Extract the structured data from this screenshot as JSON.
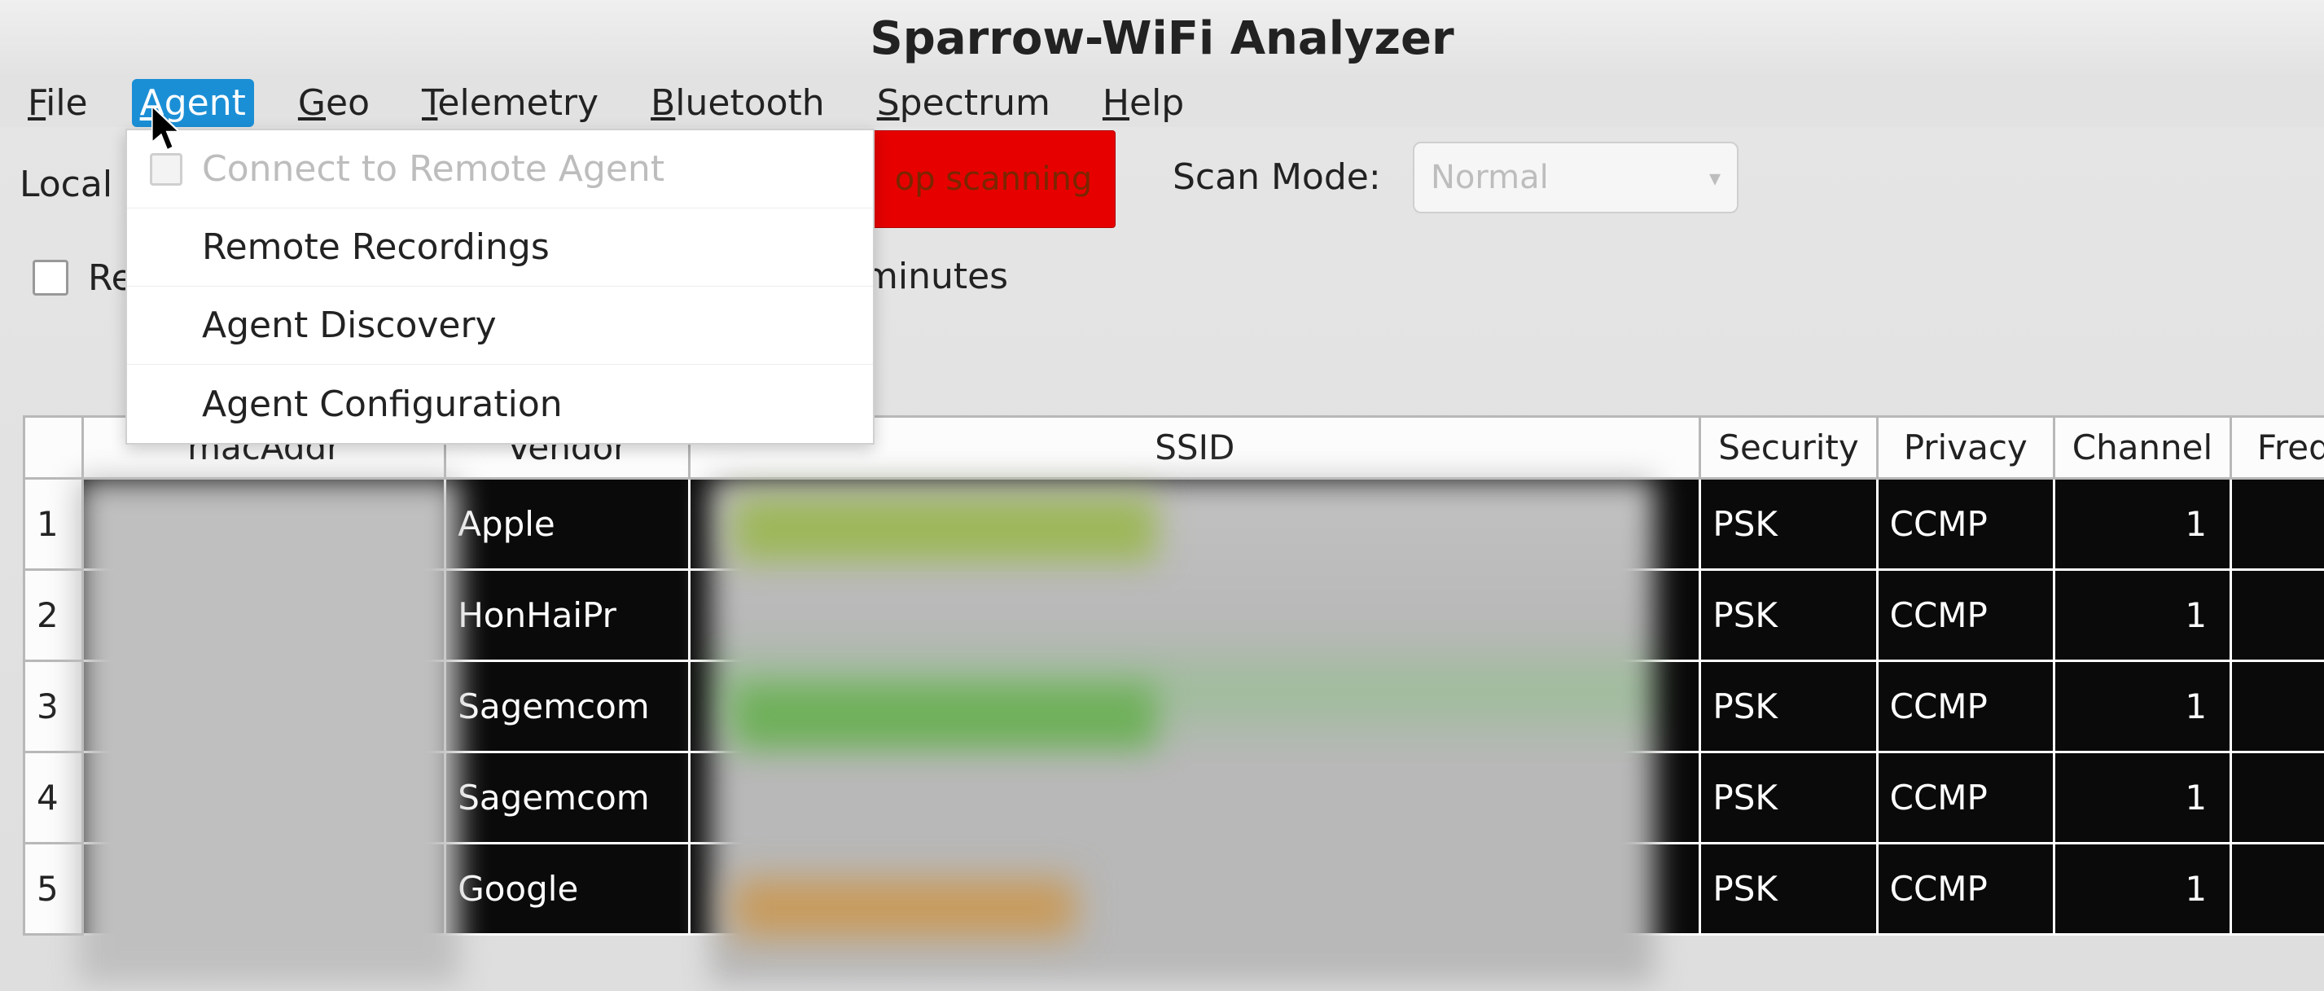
{
  "title": "Sparrow-WiFi Analyzer",
  "menubar": {
    "items": [
      {
        "label": "File",
        "mnemonic": "F"
      },
      {
        "label": "Agent",
        "mnemonic": "A",
        "active": true
      },
      {
        "label": "Geo",
        "mnemonic": "G"
      },
      {
        "label": "Telemetry",
        "mnemonic": "T"
      },
      {
        "label": "Bluetooth",
        "mnemonic": "B"
      },
      {
        "label": "Spectrum",
        "mnemonic": "S"
      },
      {
        "label": "Help",
        "mnemonic": "H"
      }
    ]
  },
  "agent_menu": {
    "items": [
      {
        "label": "Connect to Remote Agent",
        "disabled": true,
        "checkbox": true
      },
      {
        "label": "Remote Recordings"
      },
      {
        "label": "Agent Discovery"
      },
      {
        "label": "Agent Configuration"
      }
    ]
  },
  "toolbar": {
    "local_label": "Local",
    "scan_button": "op scanning",
    "scanmode_label": "Scan Mode:",
    "scanmode_value": "Normal"
  },
  "options": {
    "visible_prefix": "Re",
    "tail_label": "minutes"
  },
  "table": {
    "headers": {
      "macaddr": "macAddr",
      "vendor": "Vendor",
      "ssid": "SSID",
      "security": "Security",
      "privacy": "Privacy",
      "channel": "Channel",
      "frequency": "Freque"
    },
    "rows": [
      {
        "idx": "1",
        "vendor": "Apple",
        "security": "PSK",
        "privacy": "CCMP",
        "channel": "1"
      },
      {
        "idx": "2",
        "vendor": "HonHaiPr",
        "security": "PSK",
        "privacy": "CCMP",
        "channel": "1"
      },
      {
        "idx": "3",
        "vendor": "Sagemcom",
        "security": "PSK",
        "privacy": "CCMP",
        "channel": "1"
      },
      {
        "idx": "4",
        "vendor": "Sagemcom",
        "security": "PSK",
        "privacy": "CCMP",
        "channel": "1"
      },
      {
        "idx": "5",
        "vendor": "Google",
        "security": "PSK",
        "privacy": "CCMP",
        "channel": "1"
      }
    ]
  }
}
